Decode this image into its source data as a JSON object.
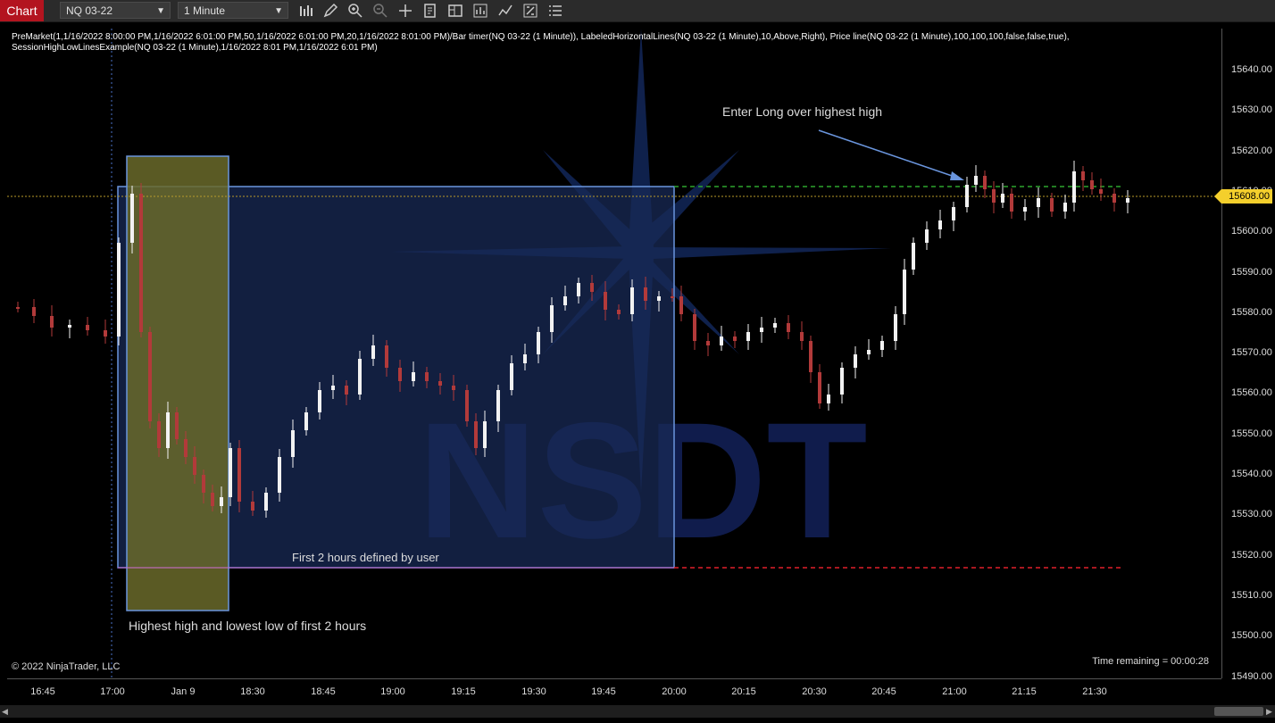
{
  "toolbar": {
    "tab_label": "Chart",
    "instrument": "NQ 03-22",
    "interval": "1 Minute",
    "icons": [
      "bar-type-icon",
      "drawing-pencil-icon",
      "zoom-in-icon",
      "zoom-out-icon",
      "crosshair-icon",
      "data-box-icon",
      "templates-icon",
      "strategies-icon",
      "indicators-icon",
      "chart-properties-icon",
      "more-icon"
    ]
  },
  "indicators_text": {
    "line1": "PreMarket(1,1/16/2022 8:00:00 PM,1/16/2022 6:01:00 PM,50,1/16/2022 6:01:00 PM,20,1/16/2022 8:01:00 PM)/Bar timer(NQ 03-22 (1 Minute)), LabeledHorizontalLines(NQ 03-22 (1 Minute),10,Above,Right), Price line(NQ 03-22 (1 Minute),100,100,100,false,false,true),",
    "line2": "SessionHighLowLinesExample(NQ 03-22 (1 Minute),1/16/2022 8:01 PM,1/16/2022 6:01 PM)"
  },
  "annotations": {
    "enter_long": "Enter Long over highest high",
    "first_two_hours": "First 2 hours defined by user",
    "high_low": "Highest high and lowest low of first 2 hours"
  },
  "watermark": "NSDT",
  "copyright": "© 2022 NinjaTrader, LLC",
  "time_remaining": "Time remaining = 00:00:28",
  "current_price": "15608.00",
  "price_axis": {
    "labels": [
      "15640.00",
      "15630.00",
      "15620.00",
      "15610.00",
      "15600.00",
      "15590.00",
      "15580.00",
      "15570.00",
      "15560.00",
      "15550.00",
      "15540.00",
      "15530.00",
      "15520.00",
      "15510.00",
      "15500.00",
      "15490.00"
    ],
    "min": 15486,
    "max": 15654
  },
  "time_axis": {
    "labels": [
      "16:45",
      "17:00",
      "Jan 9",
      "18:30",
      "18:45",
      "19:00",
      "19:15",
      "19:30",
      "19:45",
      "20:00",
      "20:15",
      "20:30",
      "20:45",
      "21:00",
      "21:15",
      "21:30"
    ]
  },
  "colors": {
    "up_candle": "#f2f2f2",
    "down_candle": "#b23a3a",
    "session_high_line": "#2ea52e",
    "session_low_line": "#e0202a",
    "box_fill": "#1a2a55",
    "highlight_fill": "#5c5c2a",
    "current_price": "#f4cf2c"
  }
}
